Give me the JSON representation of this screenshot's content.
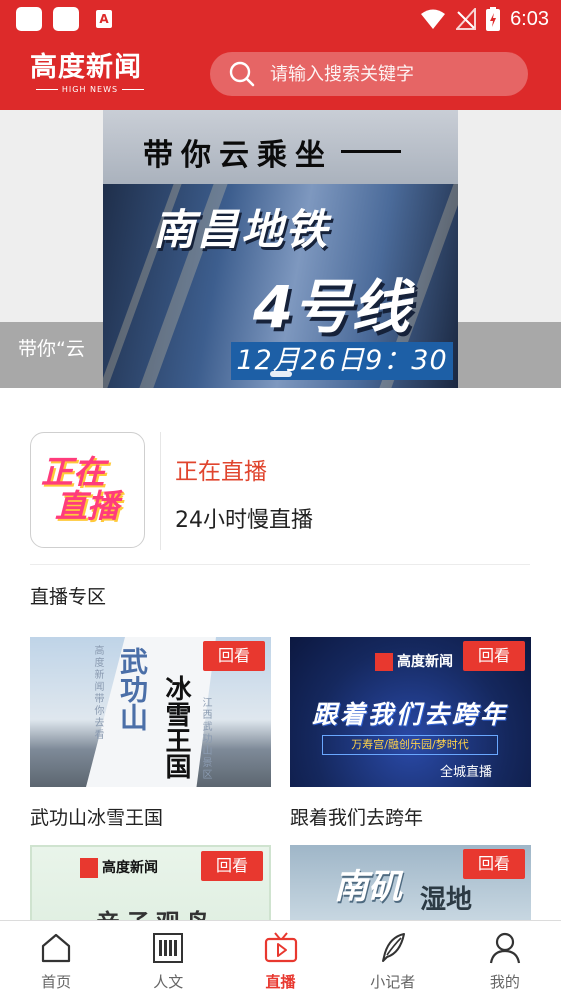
{
  "status_bar": {
    "time": "6:03",
    "app_letter": "A"
  },
  "header": {
    "logo_text": "高度新闻",
    "logo_sub": "HIGH NEWS",
    "search": {
      "placeholder": "请输入搜索关键字"
    }
  },
  "banner": {
    "caption": "带你“云",
    "poster": {
      "line1": "带你云乘坐",
      "line2": "南昌地铁",
      "line3": "4号线",
      "date": "12月26日9：30"
    }
  },
  "live": {
    "thumb_line1": "正在",
    "thumb_line2": "直播",
    "title": "正在直播",
    "subtitle": "24小时慢直播"
  },
  "section": {
    "title": "直播专区"
  },
  "cards": [
    {
      "title": "武功山冰雪王国",
      "badge": "回看",
      "art": {
        "t1": "武功山",
        "t2": "冰雪王国",
        "small1": "高度新闻带你去看",
        "small2": "江西武功山景区"
      }
    },
    {
      "title": "跟着我们去跨年",
      "badge": "回看",
      "art": {
        "logo": "高度新闻",
        "big": "跟着我们去跨年",
        "band": "万寿宫/融创乐园/梦时代",
        "city": "全城直播"
      }
    },
    {
      "title": "",
      "badge": "回看",
      "art": {
        "logo": "高度新闻",
        "big": "亲子观鸟"
      }
    },
    {
      "title": "",
      "badge": "回看",
      "art": {
        "big": "南矶",
        "big2": "湿地"
      }
    }
  ],
  "bottom_nav": {
    "items": [
      {
        "label": "首页",
        "icon": "home-icon",
        "active": false
      },
      {
        "label": "人文",
        "icon": "book-icon",
        "active": false
      },
      {
        "label": "直播",
        "icon": "tv-icon",
        "active": true
      },
      {
        "label": "小记者",
        "icon": "quill-icon",
        "active": false
      },
      {
        "label": "我的",
        "icon": "user-icon",
        "active": false
      }
    ]
  },
  "colors": {
    "brand_red": "#dd2a2a",
    "badge_red": "#e8382f",
    "live_title": "#e0452e"
  }
}
